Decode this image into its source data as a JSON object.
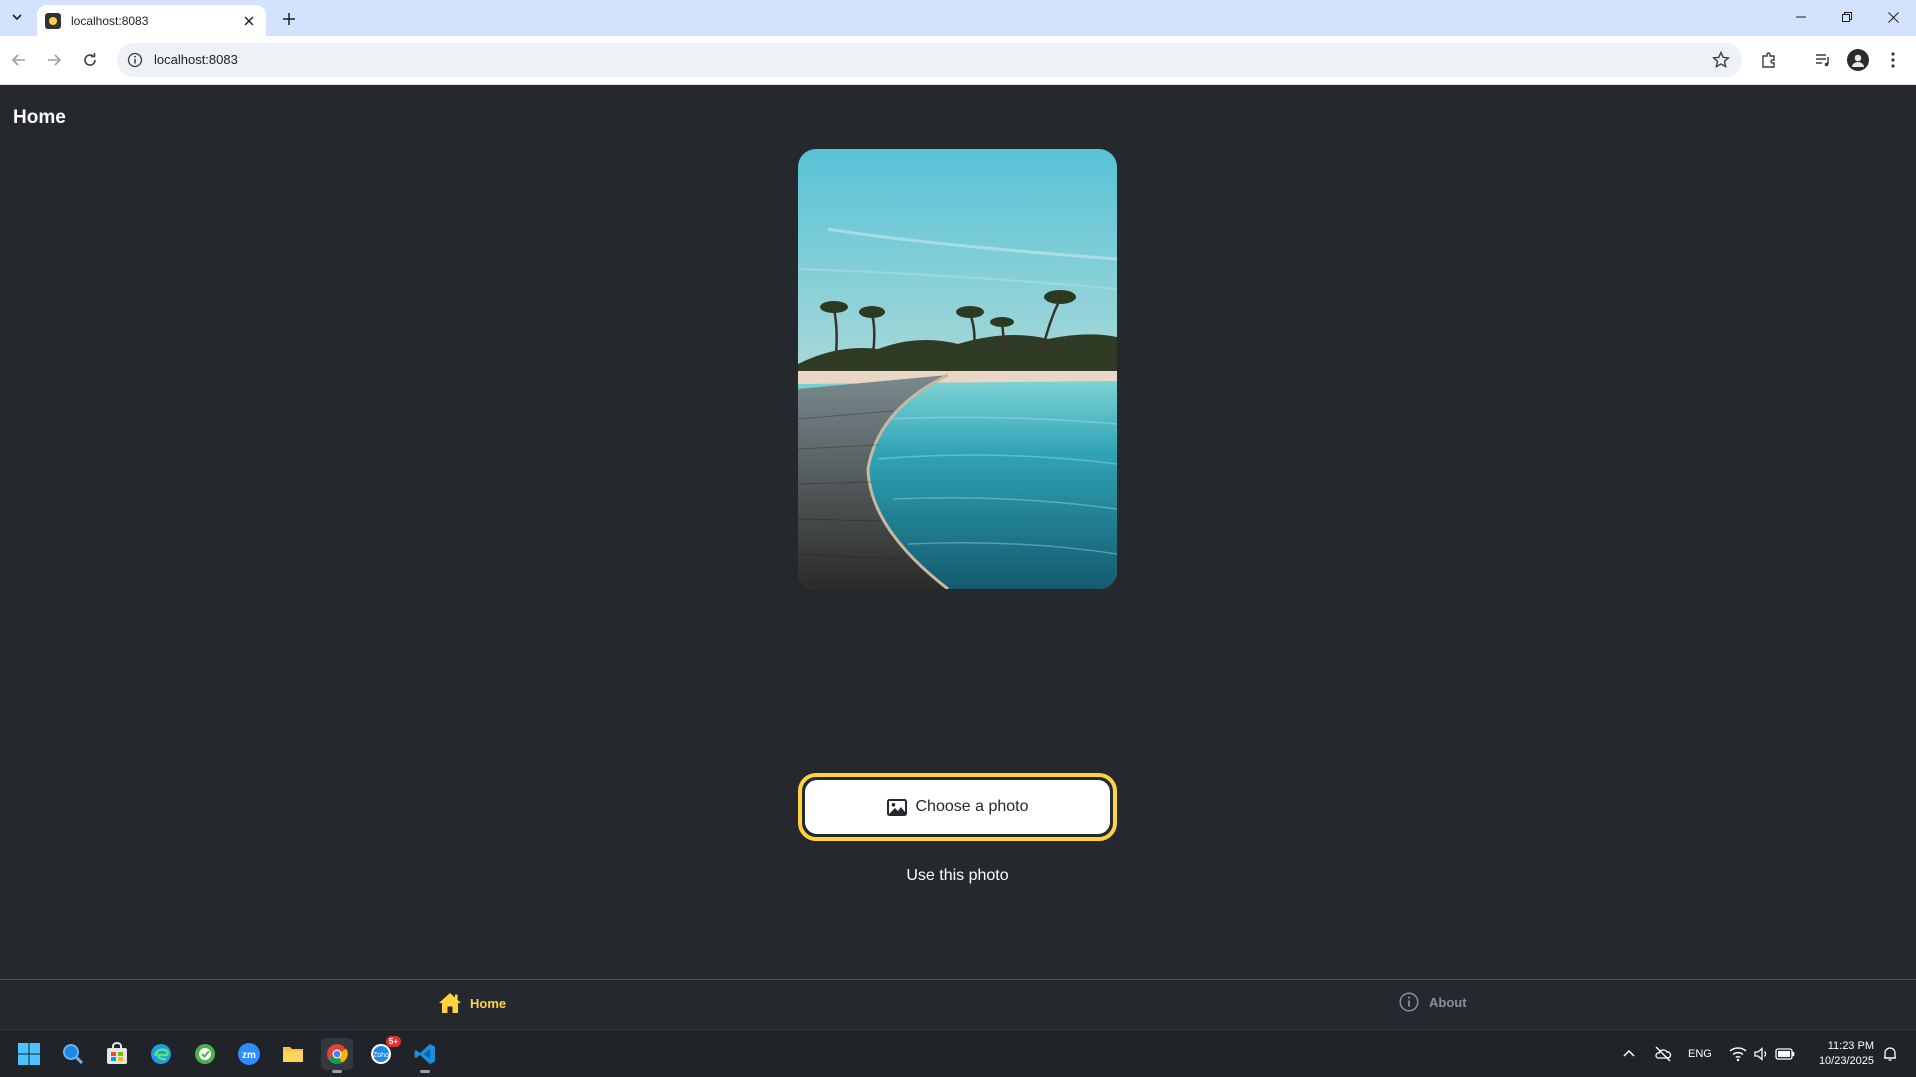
{
  "browser": {
    "tab_title": "localhost:8083",
    "url": "localhost:8083"
  },
  "app": {
    "header_title": "Home",
    "photo_alt": "Tropical beach boardwalk with palm trees",
    "choose_button_label": "Choose a photo",
    "use_photo_label": "Use this photo",
    "tabs": [
      {
        "label": "Home",
        "icon": "home-icon",
        "active": true
      },
      {
        "label": "About",
        "icon": "info-circle-icon",
        "active": false
      }
    ],
    "colors": {
      "background": "#25292e",
      "accent": "#ffd33d",
      "inactive_tab": "#8c8f95"
    }
  },
  "taskbar": {
    "apps": [
      "windows-start",
      "search",
      "microsoft-store",
      "edge",
      "app-green",
      "zoom",
      "file-explorer",
      "chrome",
      "zoho",
      "vscode"
    ],
    "badge_count": "5+",
    "language": "ENG",
    "time": "11:23 PM",
    "date": "10/23/2025"
  }
}
